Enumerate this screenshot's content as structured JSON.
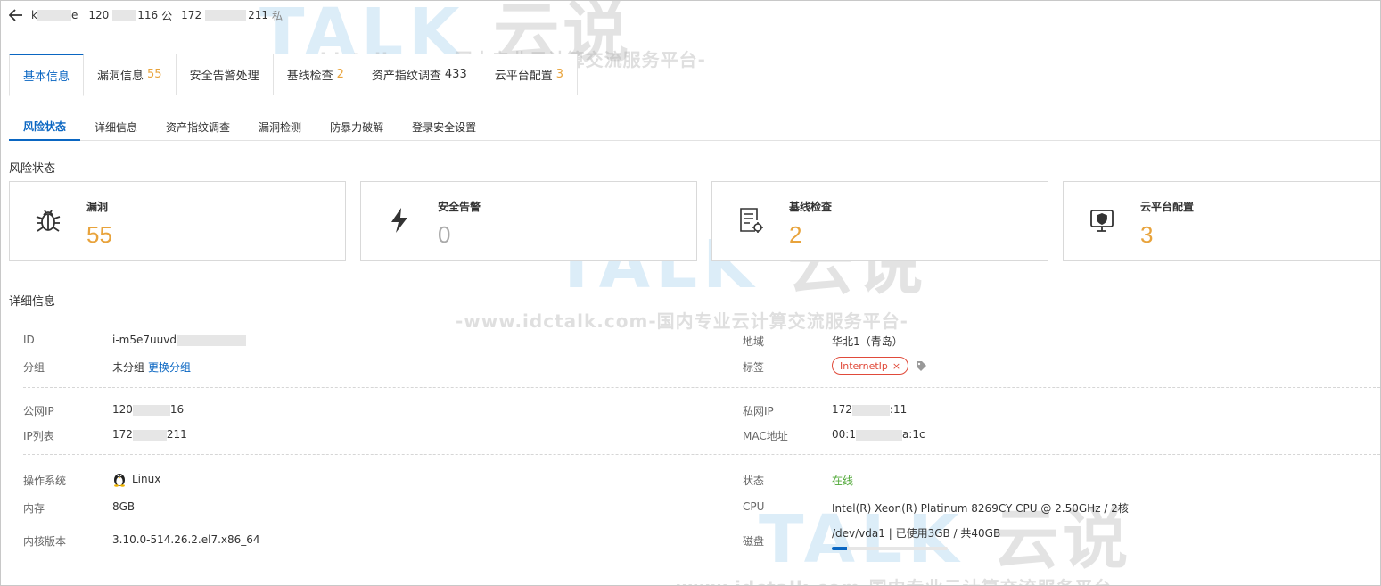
{
  "header": {
    "name_start": "k",
    "name_end": "e",
    "public_ip_start": "120",
    "public_ip_end": "116",
    "public_label": "公",
    "private_ip_start": "172",
    "private_ip_end": "211",
    "private_label": "私"
  },
  "main_tabs": [
    {
      "label": "基本信息",
      "count": ""
    },
    {
      "label": "漏洞信息",
      "count": "55"
    },
    {
      "label": "安全告警处理",
      "count": ""
    },
    {
      "label": "基线检查",
      "count": "2"
    },
    {
      "label": "资产指纹调查",
      "count": "433"
    },
    {
      "label": "云平台配置",
      "count": "3"
    }
  ],
  "sub_tabs": [
    "风险状态",
    "详细信息",
    "资产指纹调查",
    "漏洞检测",
    "防暴力破解",
    "登录安全设置"
  ],
  "risk": {
    "title": "风险状态",
    "cards": [
      {
        "label": "漏洞",
        "value": "55",
        "icon": "bug-icon"
      },
      {
        "label": "安全告警",
        "value": "0",
        "icon": "lightning-icon"
      },
      {
        "label": "基线检查",
        "value": "2",
        "icon": "checklist-icon"
      },
      {
        "label": "云平台配置",
        "value": "3",
        "icon": "monitor-shield-icon"
      }
    ]
  },
  "details": {
    "title": "详细信息",
    "id_label": "ID",
    "id_value": "i-m5e7uuvd",
    "group_label": "分组",
    "group_value": "未分组",
    "group_link": "更换分组",
    "region_label": "地域",
    "region_value": "华北1（青岛）",
    "tag_label": "标签",
    "tag_value": "InternetIp",
    "tag_close": "×",
    "public_ip_label": "公网IP",
    "public_ip_start": "120",
    "public_ip_end": "16",
    "ip_list_label": "IP列表",
    "ip_list_start": "172",
    "ip_list_end": "211",
    "private_ip_label": "私网IP",
    "private_ip_start": "172",
    "private_ip_end": ":11",
    "mac_label": "MAC地址",
    "mac_start": "00:1",
    "mac_end": "a:1c",
    "os_label": "操作系统",
    "os_value": "Linux",
    "memory_label": "内存",
    "memory_value": "8GB",
    "kernel_label": "内核版本",
    "kernel_value": "3.10.0-514.26.2.el7.x86_64",
    "status_label": "状态",
    "status_value": "在线",
    "cpu_label": "CPU",
    "cpu_value": "Intel(R) Xeon(R) Platinum 8269CY CPU @ 2.50GHz / 2核",
    "disk_label": "磁盘",
    "disk_value": "/dev/vda1 | 已使用3GB / 共40GB",
    "disk_used_fraction": 0.075
  },
  "watermark": {
    "logo": "TALK",
    "brand": "云说",
    "url": "-www.idctalk.com-国内专业云计算交流服务平台-"
  },
  "colors": {
    "accent": "#0a66c2",
    "warning": "#e8a33c",
    "online": "#52a93a",
    "tag": "#e04a3a"
  }
}
